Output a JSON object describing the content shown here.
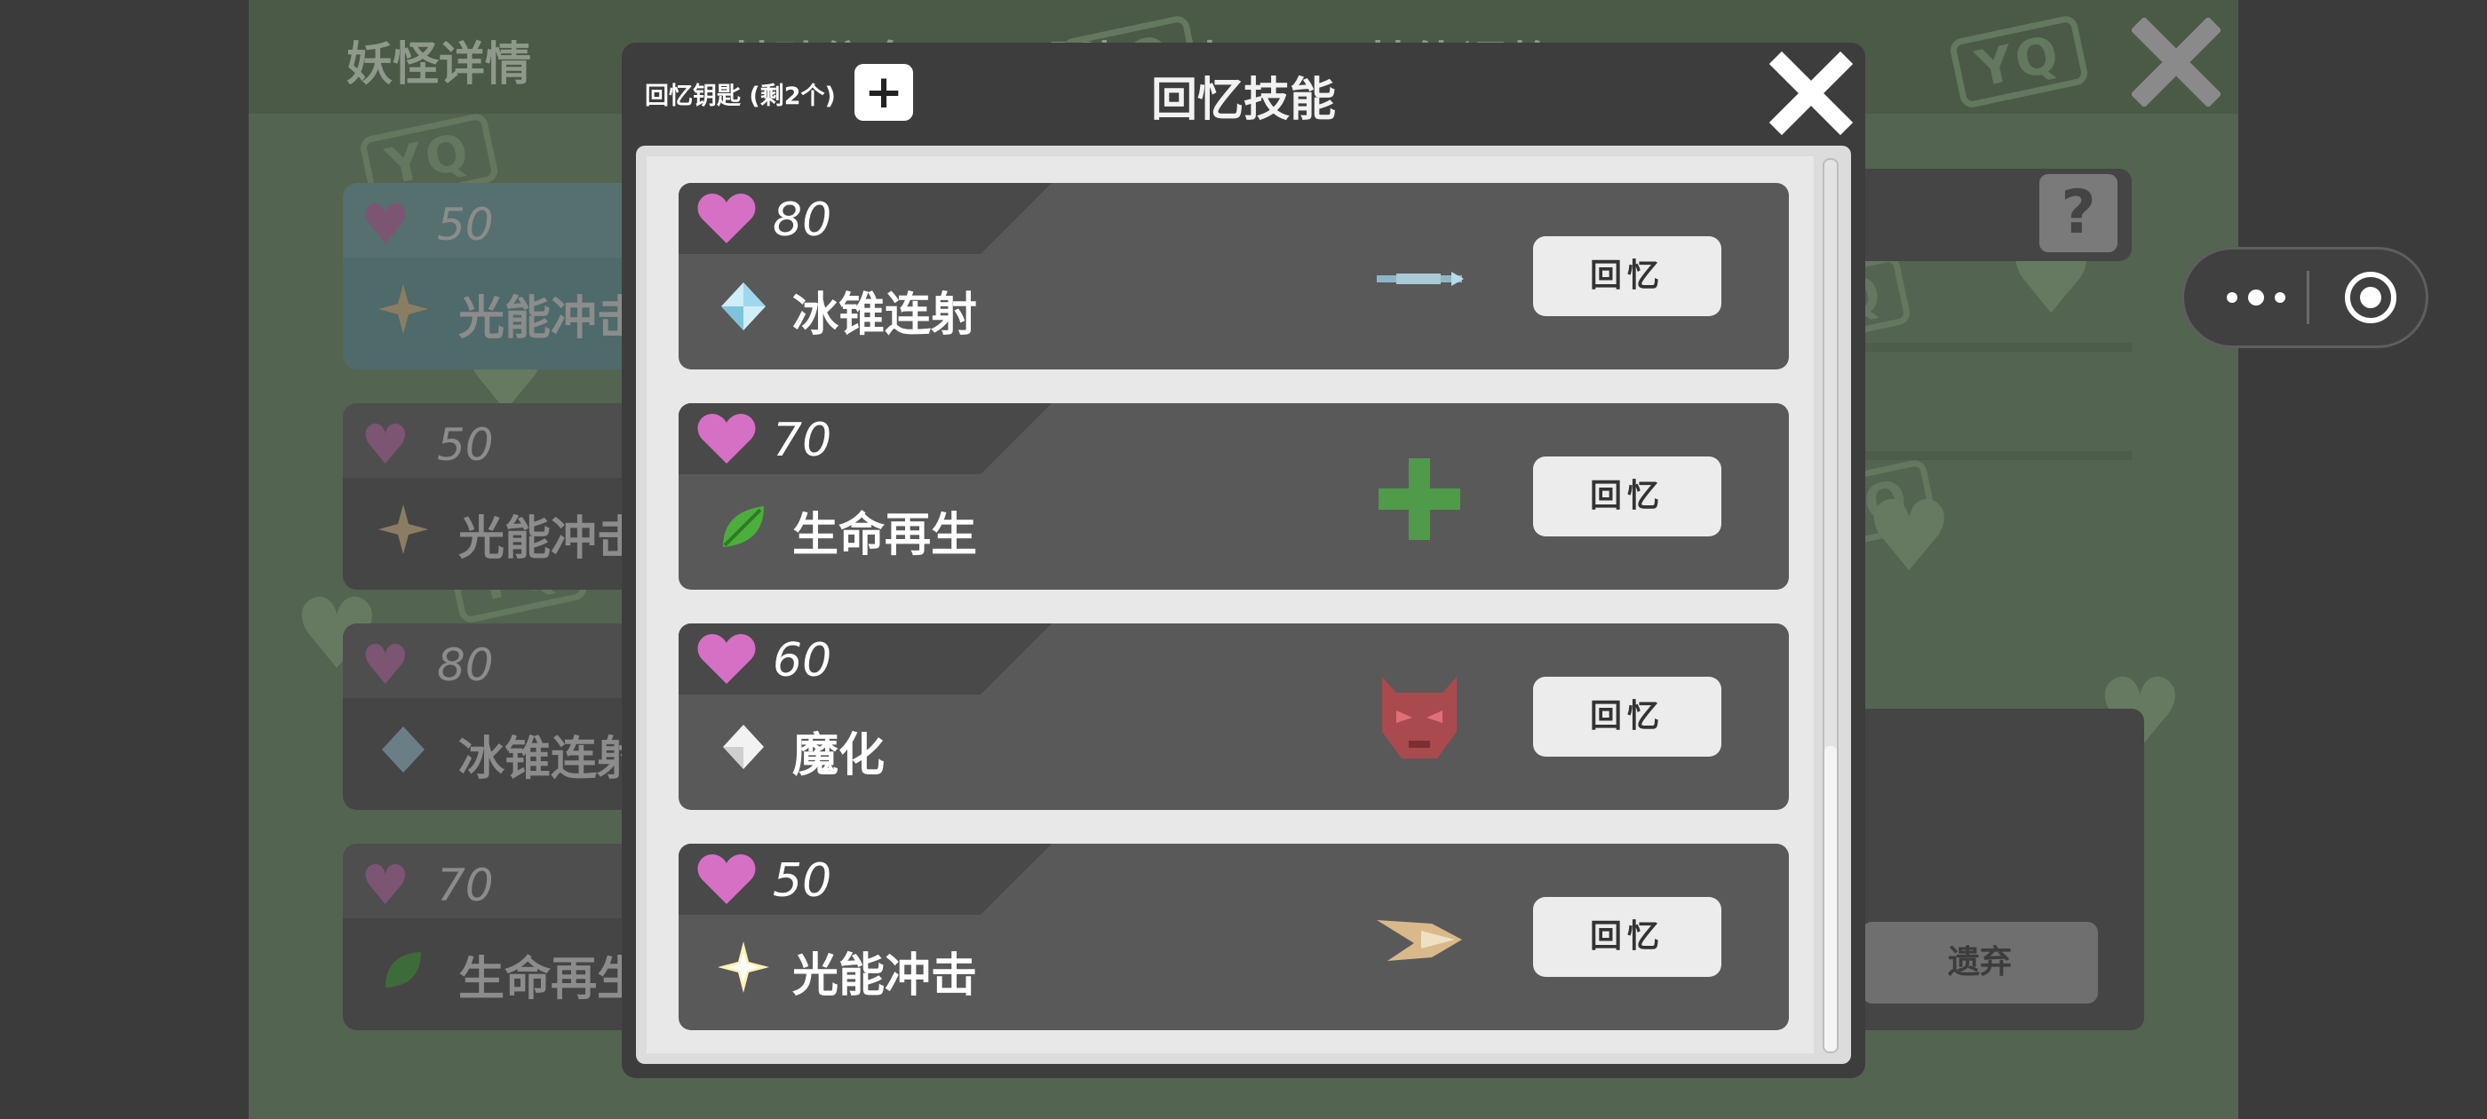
{
  "background": {
    "tabs": [
      "妖怪详情",
      "基础信息",
      "回忆元素",
      "技能调整"
    ],
    "cards": [
      {
        "cost": "50",
        "name": "光能冲击",
        "gem_icon": "star-gem-icon"
      },
      {
        "cost": "50",
        "name": "光能冲击",
        "gem_icon": "star-gem-icon"
      },
      {
        "cost": "80",
        "name": "冰锥连射",
        "gem_icon": "ice-gem-icon"
      },
      {
        "cost": "70",
        "name": "生命再生",
        "gem_icon": "leaf-gem-icon"
      }
    ],
    "discard_label": "遗弃",
    "watermark_text": "YQ",
    "help_glyph": "?"
  },
  "capsule": {
    "more_icon": "more-dots-icon",
    "close_icon": "target-icon"
  },
  "modal": {
    "title": "回忆技能",
    "key_label": "回忆钥匙 (剩2个)",
    "plus_label": "+",
    "skills": [
      {
        "cost": "80",
        "name": "冰锥连射",
        "gem_icon": "ice-crystal-icon",
        "effect_icon": "ice-arrow-icon",
        "button": "回忆"
      },
      {
        "cost": "70",
        "name": "生命再生",
        "gem_icon": "green-leaf-icon",
        "effect_icon": "green-cross-icon",
        "button": "回忆"
      },
      {
        "cost": "60",
        "name": "魔化",
        "gem_icon": "white-crystal-icon",
        "effect_icon": "demon-mask-icon",
        "button": "回忆"
      },
      {
        "cost": "50",
        "name": "光能冲击",
        "gem_icon": "golden-star-icon",
        "effect_icon": "light-wing-icon",
        "button": "回忆"
      }
    ]
  },
  "colors": {
    "accent_heart": "#d670c5",
    "game_bg": "#536450",
    "modal_bg": "#3d3d3d",
    "card_bg": "#595959"
  }
}
